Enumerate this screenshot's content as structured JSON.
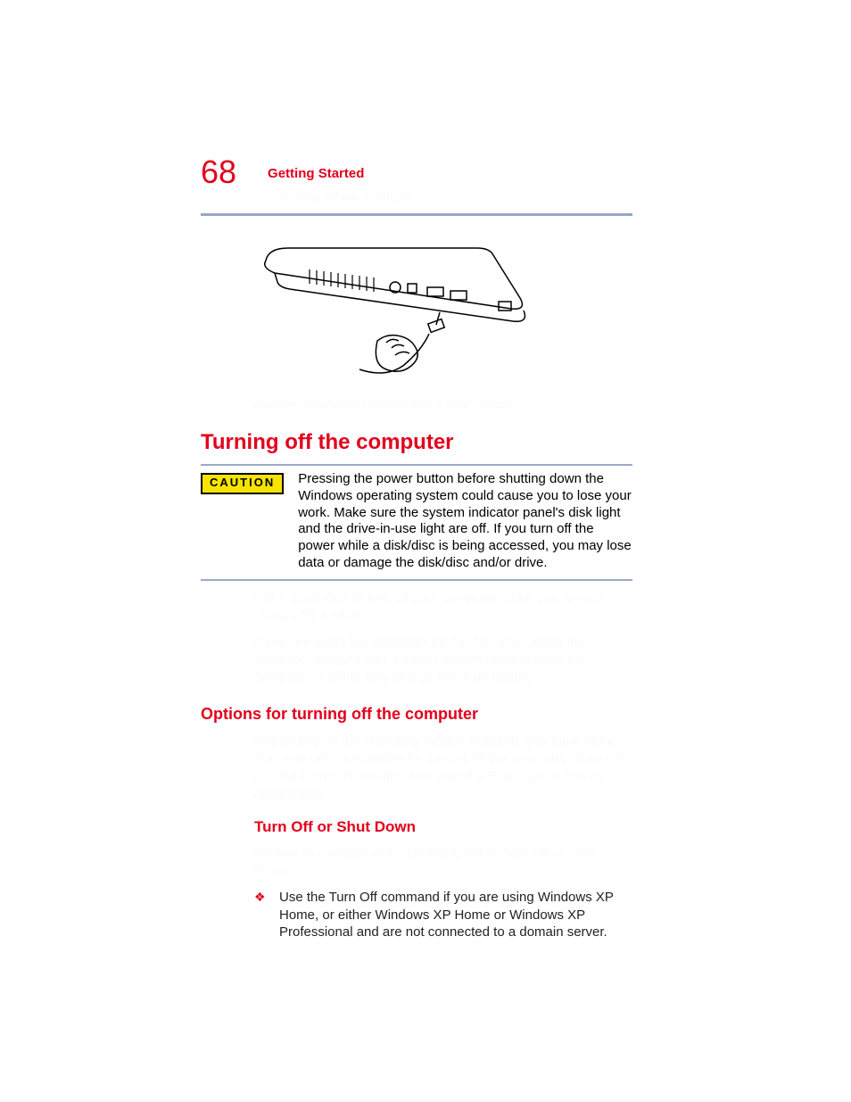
{
  "header": {
    "page_number": "68",
    "chapter": "Getting Started",
    "section_path": "Turning off the computer"
  },
  "figure": {
    "caption": "(Sample Illustration) Connecting a USB mouse",
    "alt": "laptop-side-usb-mouse-illustration"
  },
  "section": {
    "title": "Turning off the computer"
  },
  "caution": {
    "badge": "CAUTION",
    "text": "Pressing the power button before shutting down the Windows operating system could cause you to lose your work. Make sure the system indicator panel's disk light and the drive-in-use light are off. If you turn off the power while a disk/disc is being accessed, you may lose data or damage the disk/disc and/or drive."
  },
  "body": {
    "para1": "It is a good idea to turn off your computer when you are not using it for a while.",
    "para2": "If you are using the computer for the first time, leave the computer plugged into a power source (even though the computer is off) to fully charge the main battery."
  },
  "options": {
    "title": "Options for turning off the computer",
    "intro": "Depending on the operating system installed, you have more than one option available for turning off the computer: Turn Off or Shut Down, Hibernate, and Standby. Each option has its advantages.",
    "sub_title": "Turn Off or Shut Down",
    "sub_intro": "Factors to consider when choosing either Turn Off or Shut Down:",
    "bullets": [
      "Use the Turn Off command if you are using Windows XP Home, or either Windows XP Home or Windows XP Professional and are not connected to a domain server."
    ]
  }
}
